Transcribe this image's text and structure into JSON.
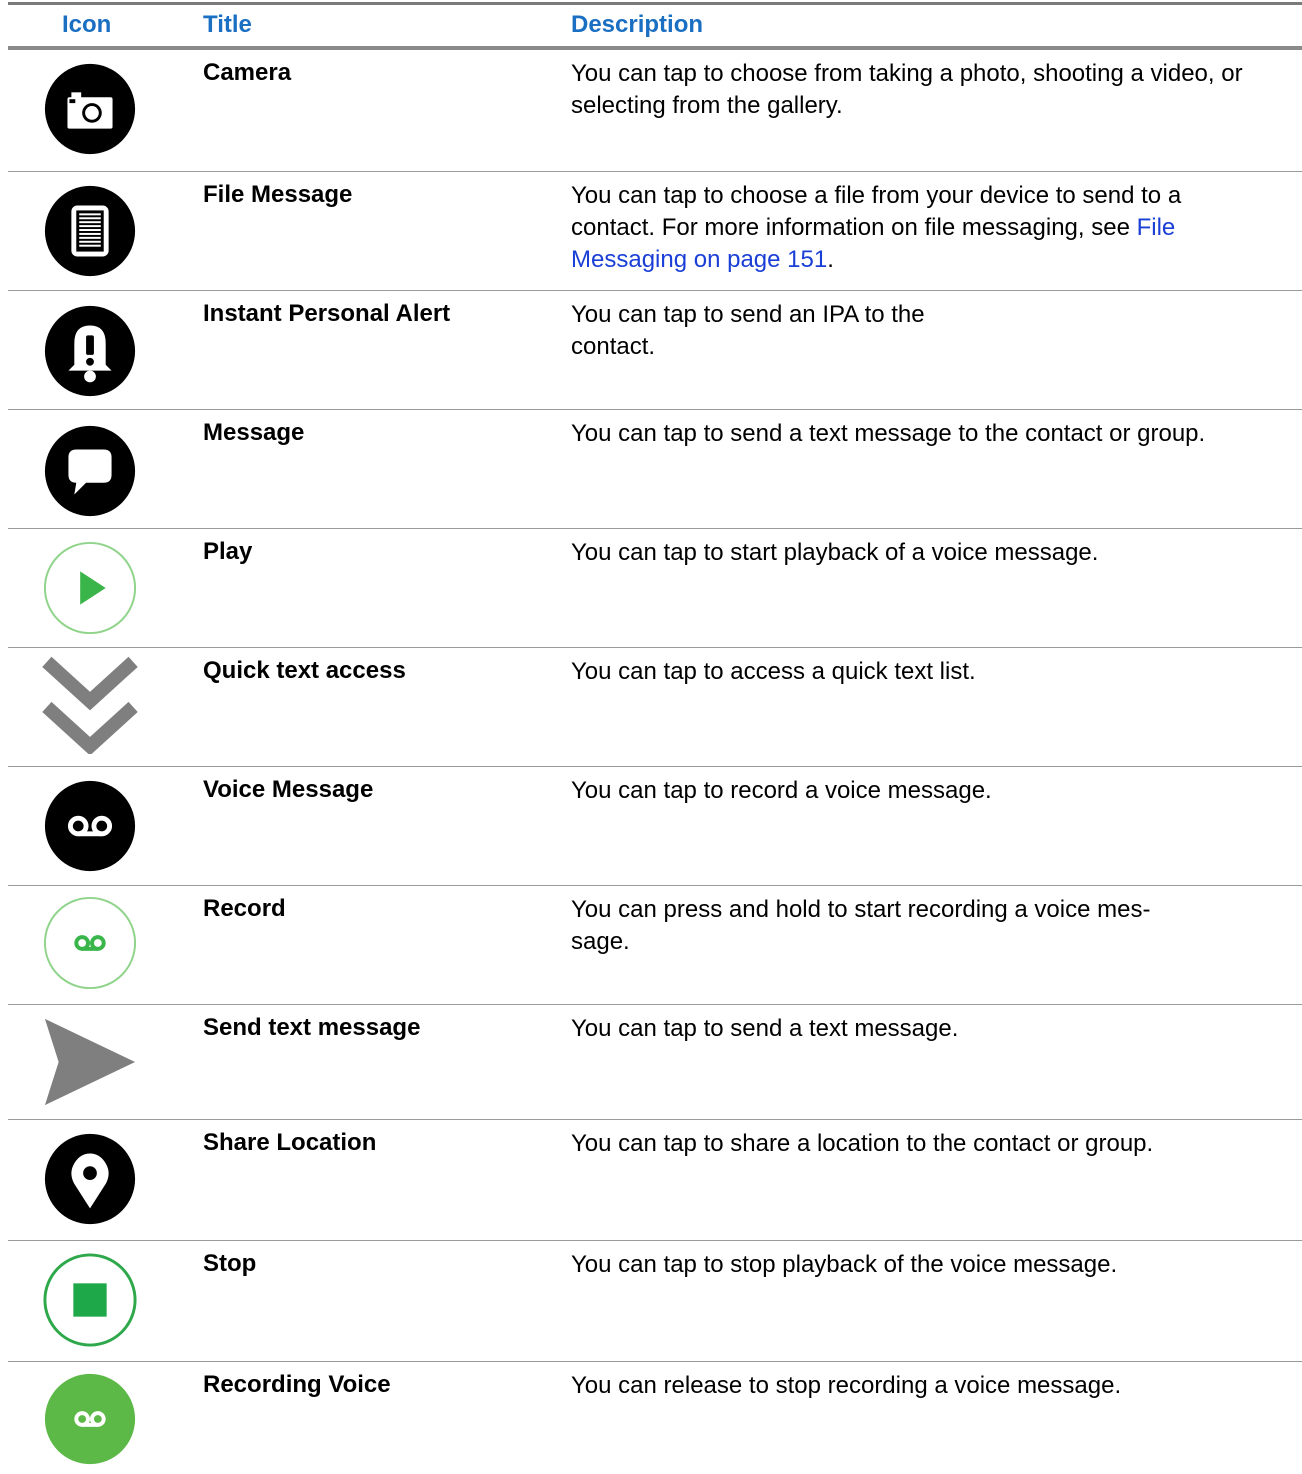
{
  "header": {
    "icon": "Icon",
    "title": "Title",
    "description": "Description"
  },
  "colors": {
    "header_text": "#1a6fc2",
    "link": "#1a3fd6",
    "green": "#3ab54a",
    "green_fill": "#5cb947",
    "gray_icon": "#7f7f7f"
  },
  "rows": [
    {
      "icon": "camera-icon",
      "title": "Camera",
      "description": "You can tap to choose from taking a photo, shooting a video, or selecting from the gallery."
    },
    {
      "icon": "file-message-icon",
      "title": "File Message",
      "description_before": "You can tap to choose a file from your device to send to a contact. For more information on file messaging, see ",
      "description_link": "File Messaging on page 151",
      "description_after": "."
    },
    {
      "icon": "alert-bell-icon",
      "title": "Instant Personal Alert",
      "description_line1": "You can tap to send an IPA to the",
      "description_line2": "contact."
    },
    {
      "icon": "message-bubble-icon",
      "title": "Message",
      "description": "You can tap to send a text message to the contact or group."
    },
    {
      "icon": "play-icon",
      "title": "Play",
      "description": "You can tap to start playback of a voice message."
    },
    {
      "icon": "quick-text-chevron-icon",
      "title": "Quick text access",
      "description": "You can tap to access a quick text list."
    },
    {
      "icon": "voicemail-icon",
      "title": "Voice Message",
      "description": "You can tap to record a voice message."
    },
    {
      "icon": "record-icon",
      "title": "Record",
      "description_line1": "You can press and hold to start recording a voice mes-",
      "description_line2": "sage."
    },
    {
      "icon": "send-arrow-icon",
      "title": "Send text message",
      "description": "You can tap to send a text message."
    },
    {
      "icon": "location-pin-icon",
      "title": "Share Location",
      "description": "You can tap to share a location to the contact or group."
    },
    {
      "icon": "stop-icon",
      "title": "Stop",
      "description": "You can tap to stop playback of the voice message."
    },
    {
      "icon": "recording-voice-icon",
      "title": "Recording Voice",
      "description": "You can release to stop recording a voice message."
    }
  ]
}
